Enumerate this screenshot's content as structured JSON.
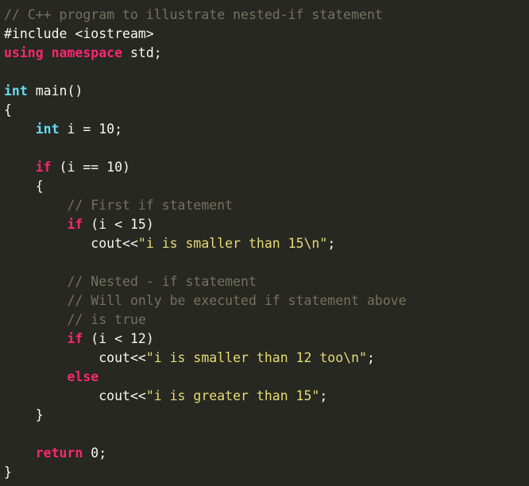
{
  "editor": {
    "background": "#272822",
    "colors": {
      "comment": "#75715e",
      "keyword": "#f92672",
      "type": "#66d9ef",
      "string": "#e6db74",
      "plain": "#f8f8f2"
    },
    "lines": [
      [
        {
          "t": "// C++ program to illustrate nested-if statement",
          "c": "comment"
        }
      ],
      [
        {
          "t": "#include <iostream>",
          "c": "plain"
        }
      ],
      [
        {
          "t": "using",
          "c": "keyword"
        },
        {
          "t": " ",
          "c": "plain"
        },
        {
          "t": "namespace",
          "c": "keyword"
        },
        {
          "t": " std;",
          "c": "plain"
        }
      ],
      [],
      [
        {
          "t": "int",
          "c": "type"
        },
        {
          "t": " main()",
          "c": "plain"
        }
      ],
      [
        {
          "t": "{",
          "c": "plain"
        }
      ],
      [
        {
          "t": "    ",
          "c": "plain"
        },
        {
          "t": "int",
          "c": "type"
        },
        {
          "t": " i = 10;",
          "c": "plain"
        }
      ],
      [],
      [
        {
          "t": "    ",
          "c": "plain"
        },
        {
          "t": "if",
          "c": "keyword"
        },
        {
          "t": " (i == 10)",
          "c": "plain"
        }
      ],
      [
        {
          "t": "    {",
          "c": "plain"
        }
      ],
      [
        {
          "t": "        ",
          "c": "plain"
        },
        {
          "t": "// First if statement",
          "c": "comment"
        }
      ],
      [
        {
          "t": "        ",
          "c": "plain"
        },
        {
          "t": "if",
          "c": "keyword"
        },
        {
          "t": " (i < 15)",
          "c": "plain"
        }
      ],
      [
        {
          "t": "           cout<<",
          "c": "plain"
        },
        {
          "t": "\"i is smaller than 15\\n\"",
          "c": "string"
        },
        {
          "t": ";",
          "c": "plain"
        }
      ],
      [],
      [
        {
          "t": "        ",
          "c": "plain"
        },
        {
          "t": "// Nested - if statement",
          "c": "comment"
        }
      ],
      [
        {
          "t": "        ",
          "c": "plain"
        },
        {
          "t": "// Will only be executed if statement above",
          "c": "comment"
        }
      ],
      [
        {
          "t": "        ",
          "c": "plain"
        },
        {
          "t": "// is true",
          "c": "comment"
        }
      ],
      [
        {
          "t": "        ",
          "c": "plain"
        },
        {
          "t": "if",
          "c": "keyword"
        },
        {
          "t": " (i < 12)",
          "c": "plain"
        }
      ],
      [
        {
          "t": "            cout<<",
          "c": "plain"
        },
        {
          "t": "\"i is smaller than 12 too\\n\"",
          "c": "string"
        },
        {
          "t": ";",
          "c": "plain"
        }
      ],
      [
        {
          "t": "        ",
          "c": "plain"
        },
        {
          "t": "else",
          "c": "keyword"
        }
      ],
      [
        {
          "t": "            cout<<",
          "c": "plain"
        },
        {
          "t": "\"i is greater than 15\"",
          "c": "string"
        },
        {
          "t": ";",
          "c": "plain"
        }
      ],
      [
        {
          "t": "    }",
          "c": "plain"
        }
      ],
      [],
      [
        {
          "t": "    ",
          "c": "plain"
        },
        {
          "t": "return",
          "c": "keyword"
        },
        {
          "t": " 0;",
          "c": "plain"
        }
      ],
      [
        {
          "t": "}",
          "c": "plain"
        }
      ]
    ]
  }
}
